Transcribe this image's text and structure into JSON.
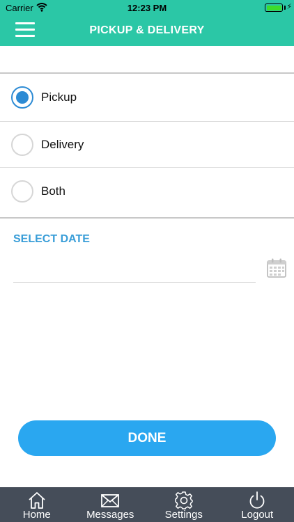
{
  "status_bar": {
    "carrier": "Carrier",
    "time": "12:23 PM"
  },
  "header": {
    "title": "PICKUP & DELIVERY"
  },
  "options": [
    {
      "label": "Pickup",
      "selected": true
    },
    {
      "label": "Delivery",
      "selected": false
    },
    {
      "label": "Both",
      "selected": false
    }
  ],
  "date": {
    "label": "SELECT DATE",
    "value": "",
    "placeholder": ""
  },
  "done_label": "DONE",
  "tabs": [
    {
      "label": "Home",
      "icon": "home-icon"
    },
    {
      "label": "Messages",
      "icon": "envelope-icon"
    },
    {
      "label": "Settings",
      "icon": "gear-icon"
    },
    {
      "label": "Logout",
      "icon": "power-icon"
    }
  ],
  "colors": {
    "accent": "#2bc7a6",
    "radio": "#2d8bd4",
    "button": "#2aa7f0",
    "tabbar": "#454d59",
    "section_label": "#3a9ed8"
  }
}
